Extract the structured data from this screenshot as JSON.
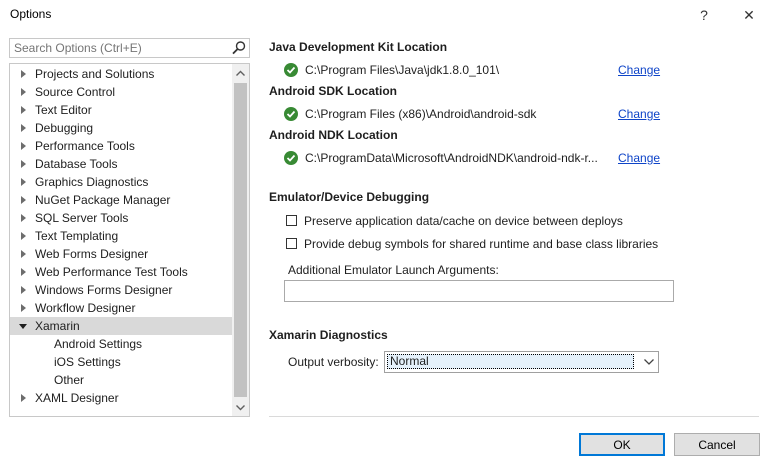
{
  "window": {
    "title": "Options",
    "help_glyph": "?",
    "close_glyph": "✕"
  },
  "search": {
    "placeholder": "Search Options (Ctrl+E)"
  },
  "tree": {
    "items": [
      {
        "label": "Projects and Solutions",
        "state": "collapsed",
        "level": 0
      },
      {
        "label": "Source Control",
        "state": "collapsed",
        "level": 0
      },
      {
        "label": "Text Editor",
        "state": "collapsed",
        "level": 0
      },
      {
        "label": "Debugging",
        "state": "collapsed",
        "level": 0
      },
      {
        "label": "Performance Tools",
        "state": "collapsed",
        "level": 0
      },
      {
        "label": "Database Tools",
        "state": "collapsed",
        "level": 0
      },
      {
        "label": "Graphics Diagnostics",
        "state": "collapsed",
        "level": 0
      },
      {
        "label": "NuGet Package Manager",
        "state": "collapsed",
        "level": 0
      },
      {
        "label": "SQL Server Tools",
        "state": "collapsed",
        "level": 0
      },
      {
        "label": "Text Templating",
        "state": "collapsed",
        "level": 0
      },
      {
        "label": "Web Forms Designer",
        "state": "collapsed",
        "level": 0
      },
      {
        "label": "Web Performance Test Tools",
        "state": "collapsed",
        "level": 0
      },
      {
        "label": "Windows Forms Designer",
        "state": "collapsed",
        "level": 0
      },
      {
        "label": "Workflow Designer",
        "state": "collapsed",
        "level": 0
      },
      {
        "label": "Xamarin",
        "state": "expanded",
        "level": 0,
        "selected": true
      },
      {
        "label": "Android Settings",
        "state": "leaf",
        "level": 1
      },
      {
        "label": "iOS Settings",
        "state": "leaf",
        "level": 1
      },
      {
        "label": "Other",
        "state": "leaf",
        "level": 1
      },
      {
        "label": "XAML Designer",
        "state": "collapsed",
        "level": 0
      }
    ]
  },
  "locations": [
    {
      "title": "Java Development Kit Location",
      "path": "C:\\Program Files\\Java\\jdk1.8.0_101\\",
      "link": "Change"
    },
    {
      "title": "Android SDK Location",
      "path": "C:\\Program Files (x86)\\Android\\android-sdk",
      "link": "Change"
    },
    {
      "title": "Android NDK Location",
      "path": "C:\\ProgramData\\Microsoft\\AndroidNDK\\android-ndk-r...",
      "link": "Change"
    }
  ],
  "emulator": {
    "title": "Emulator/Device Debugging",
    "options": [
      {
        "label": "Preserve application data/cache on device between deploys",
        "checked": false
      },
      {
        "label": "Provide debug symbols for shared runtime and base class libraries",
        "checked": false
      }
    ],
    "args_label": "Additional Emulator Launch Arguments:",
    "args_value": ""
  },
  "diagnostics": {
    "title": "Xamarin Diagnostics",
    "verbosity_label": "Output verbosity:",
    "verbosity_value": "Normal"
  },
  "buttons": {
    "ok": "OK",
    "cancel": "Cancel"
  },
  "colors": {
    "success": "#388a34",
    "link": "#0e44c8",
    "selection": "#d9d9d9",
    "default_button_border": "#0078d7"
  }
}
